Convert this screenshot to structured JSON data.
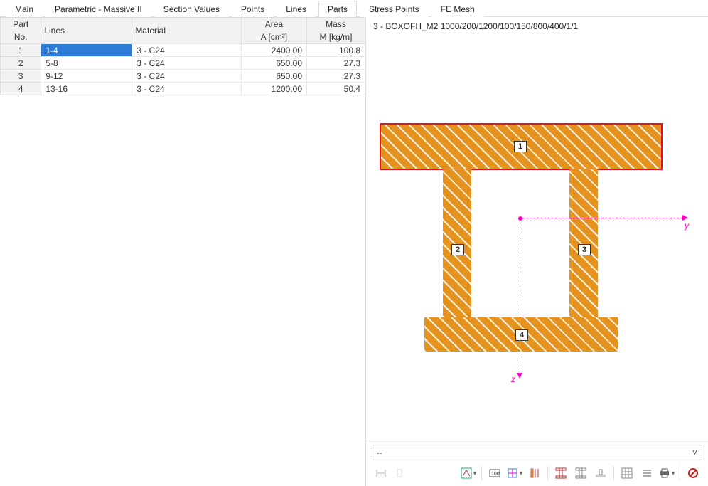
{
  "tabs": [
    "Main",
    "Parametric - Massive II",
    "Section Values",
    "Points",
    "Lines",
    "Parts",
    "Stress Points",
    "FE Mesh"
  ],
  "active_tab": "Parts",
  "columns": {
    "part_no_1": "Part",
    "part_no_2": "No.",
    "lines": "Lines",
    "material": "Material",
    "area_1": "Area",
    "area_2": "A [cm²]",
    "mass_1": "Mass",
    "mass_2": "M [kg/m]"
  },
  "rows": [
    {
      "no": "1",
      "lines": "1-4",
      "material": "3 - C24",
      "area": "2400.00",
      "mass": "100.8",
      "selected": true
    },
    {
      "no": "2",
      "lines": "5-8",
      "material": "3 - C24",
      "area": "650.00",
      "mass": "27.3",
      "selected": false
    },
    {
      "no": "3",
      "lines": "9-12",
      "material": "3 - C24",
      "area": "650.00",
      "mass": "27.3",
      "selected": false
    },
    {
      "no": "4",
      "lines": "13-16",
      "material": "3 - C24",
      "area": "1200.00",
      "mass": "50.4",
      "selected": false
    }
  ],
  "preview_title": "3 - BOXOFH_M2 1000/200/1200/100/150/800/400/1/1",
  "dropdown_value": "--",
  "axis_labels": {
    "y": "y",
    "z": "z"
  },
  "part_tags": {
    "1": "1",
    "2": "2",
    "3": "3",
    "4": "4"
  }
}
